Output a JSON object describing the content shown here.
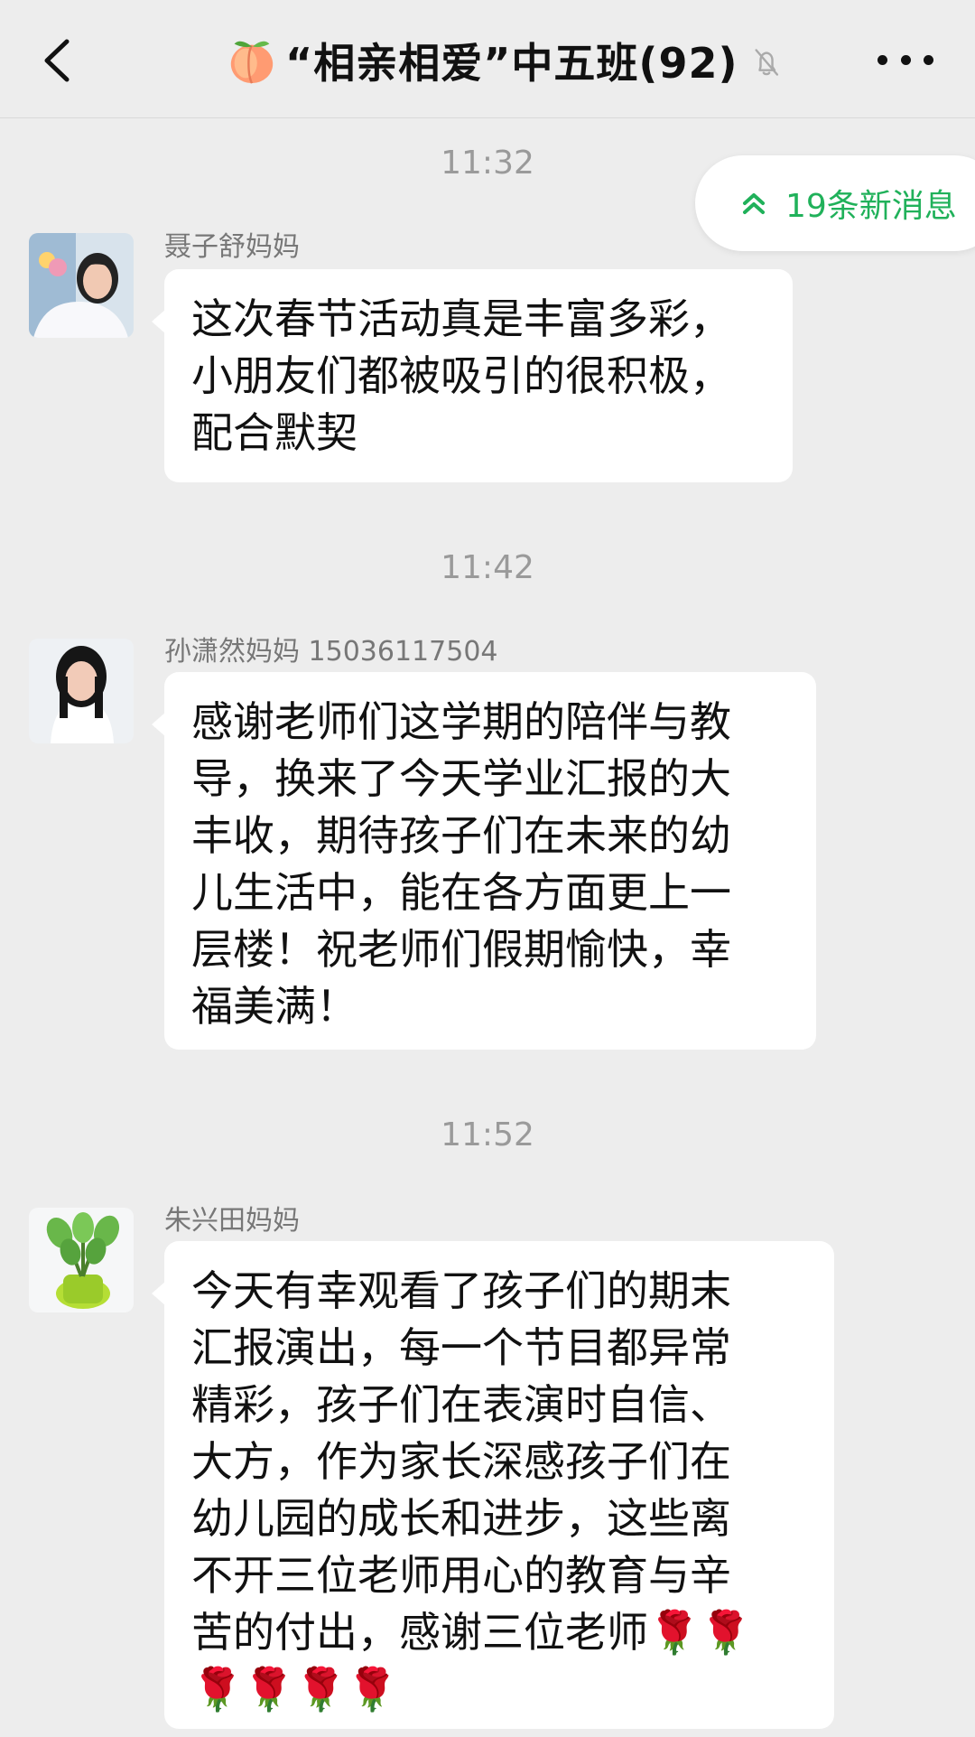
{
  "header": {
    "title": "“相亲相爱”中五班(92)",
    "icons": {
      "back": "chevron-left-icon",
      "group_emoji": "peach-icon",
      "mute": "muted-bell-icon",
      "more": "more-dots-icon"
    }
  },
  "new_messages": {
    "label": "19条新消息",
    "icon": "double-chevron-up-icon",
    "color": "#20b15a"
  },
  "messages": [
    {
      "time": "11:32",
      "sender": "聂子舒妈妈",
      "text": "这次春节活动真是丰富多彩，\n小朋友们都被吸引的很积极，\n配合默契",
      "avatar": "woman-avatar-1"
    },
    {
      "time": "11:42",
      "sender": "孙潇然妈妈 15036117504",
      "text": "感谢老师们这学期的陪伴与教\n导，换来了今天学业汇报的大\n丰收，期待孩子们在未来的幼\n儿生活中，能在各方面更上一\n层楼！祝老师们假期愉快，幸\n福美满！",
      "avatar": "woman-avatar-2"
    },
    {
      "time": "11:52",
      "sender": "朱兴田妈妈",
      "text": "今天有幸观看了孩子们的期末\n汇报演出，每一个节目都异常\n精彩，孩子们在表演时自信、\n大方，作为家长深感孩子们在\n幼儿园的成长和进步，这些离\n不开三位老师用心的教育与辛\n苦的付出，感谢三位老师🌹🌹\n🌹🌹🌹🌹",
      "avatar": "plant-avatar"
    }
  ],
  "colors": {
    "background": "#ededed",
    "bubble": "#ffffff",
    "accent": "#20b15a"
  }
}
